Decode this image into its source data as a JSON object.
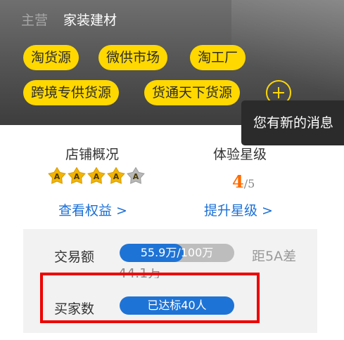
{
  "shop": {
    "main_label": "主营",
    "main_value": "家装建材"
  },
  "tags": [
    "淘货源",
    "微供市场",
    "淘工厂",
    "跨境专供货源",
    "货通天下货源"
  ],
  "tooltip": "您有新的消息",
  "overview": {
    "title": "店铺概况",
    "link": "查看权益 >",
    "star_letter": "A",
    "stars_total": 5,
    "stars_filled": 4
  },
  "rating": {
    "title": "体验星级",
    "value": "4",
    "max": "/5",
    "link": "提升星级 >"
  },
  "trade": {
    "label": "交易额",
    "progress_text": "55.9万/100万",
    "progress_fraction": 0.559,
    "gap_label": "距5A差",
    "gap_value": "44.1万"
  },
  "buyers": {
    "label": "买家数",
    "status": "已达标40人"
  },
  "colors": {
    "accent_yellow": "#ffd800",
    "link_blue": "#1a6fd6",
    "progress_blue": "#1e73d6",
    "highlight_red": "#ee0000",
    "score_orange": "#ff6a00"
  }
}
